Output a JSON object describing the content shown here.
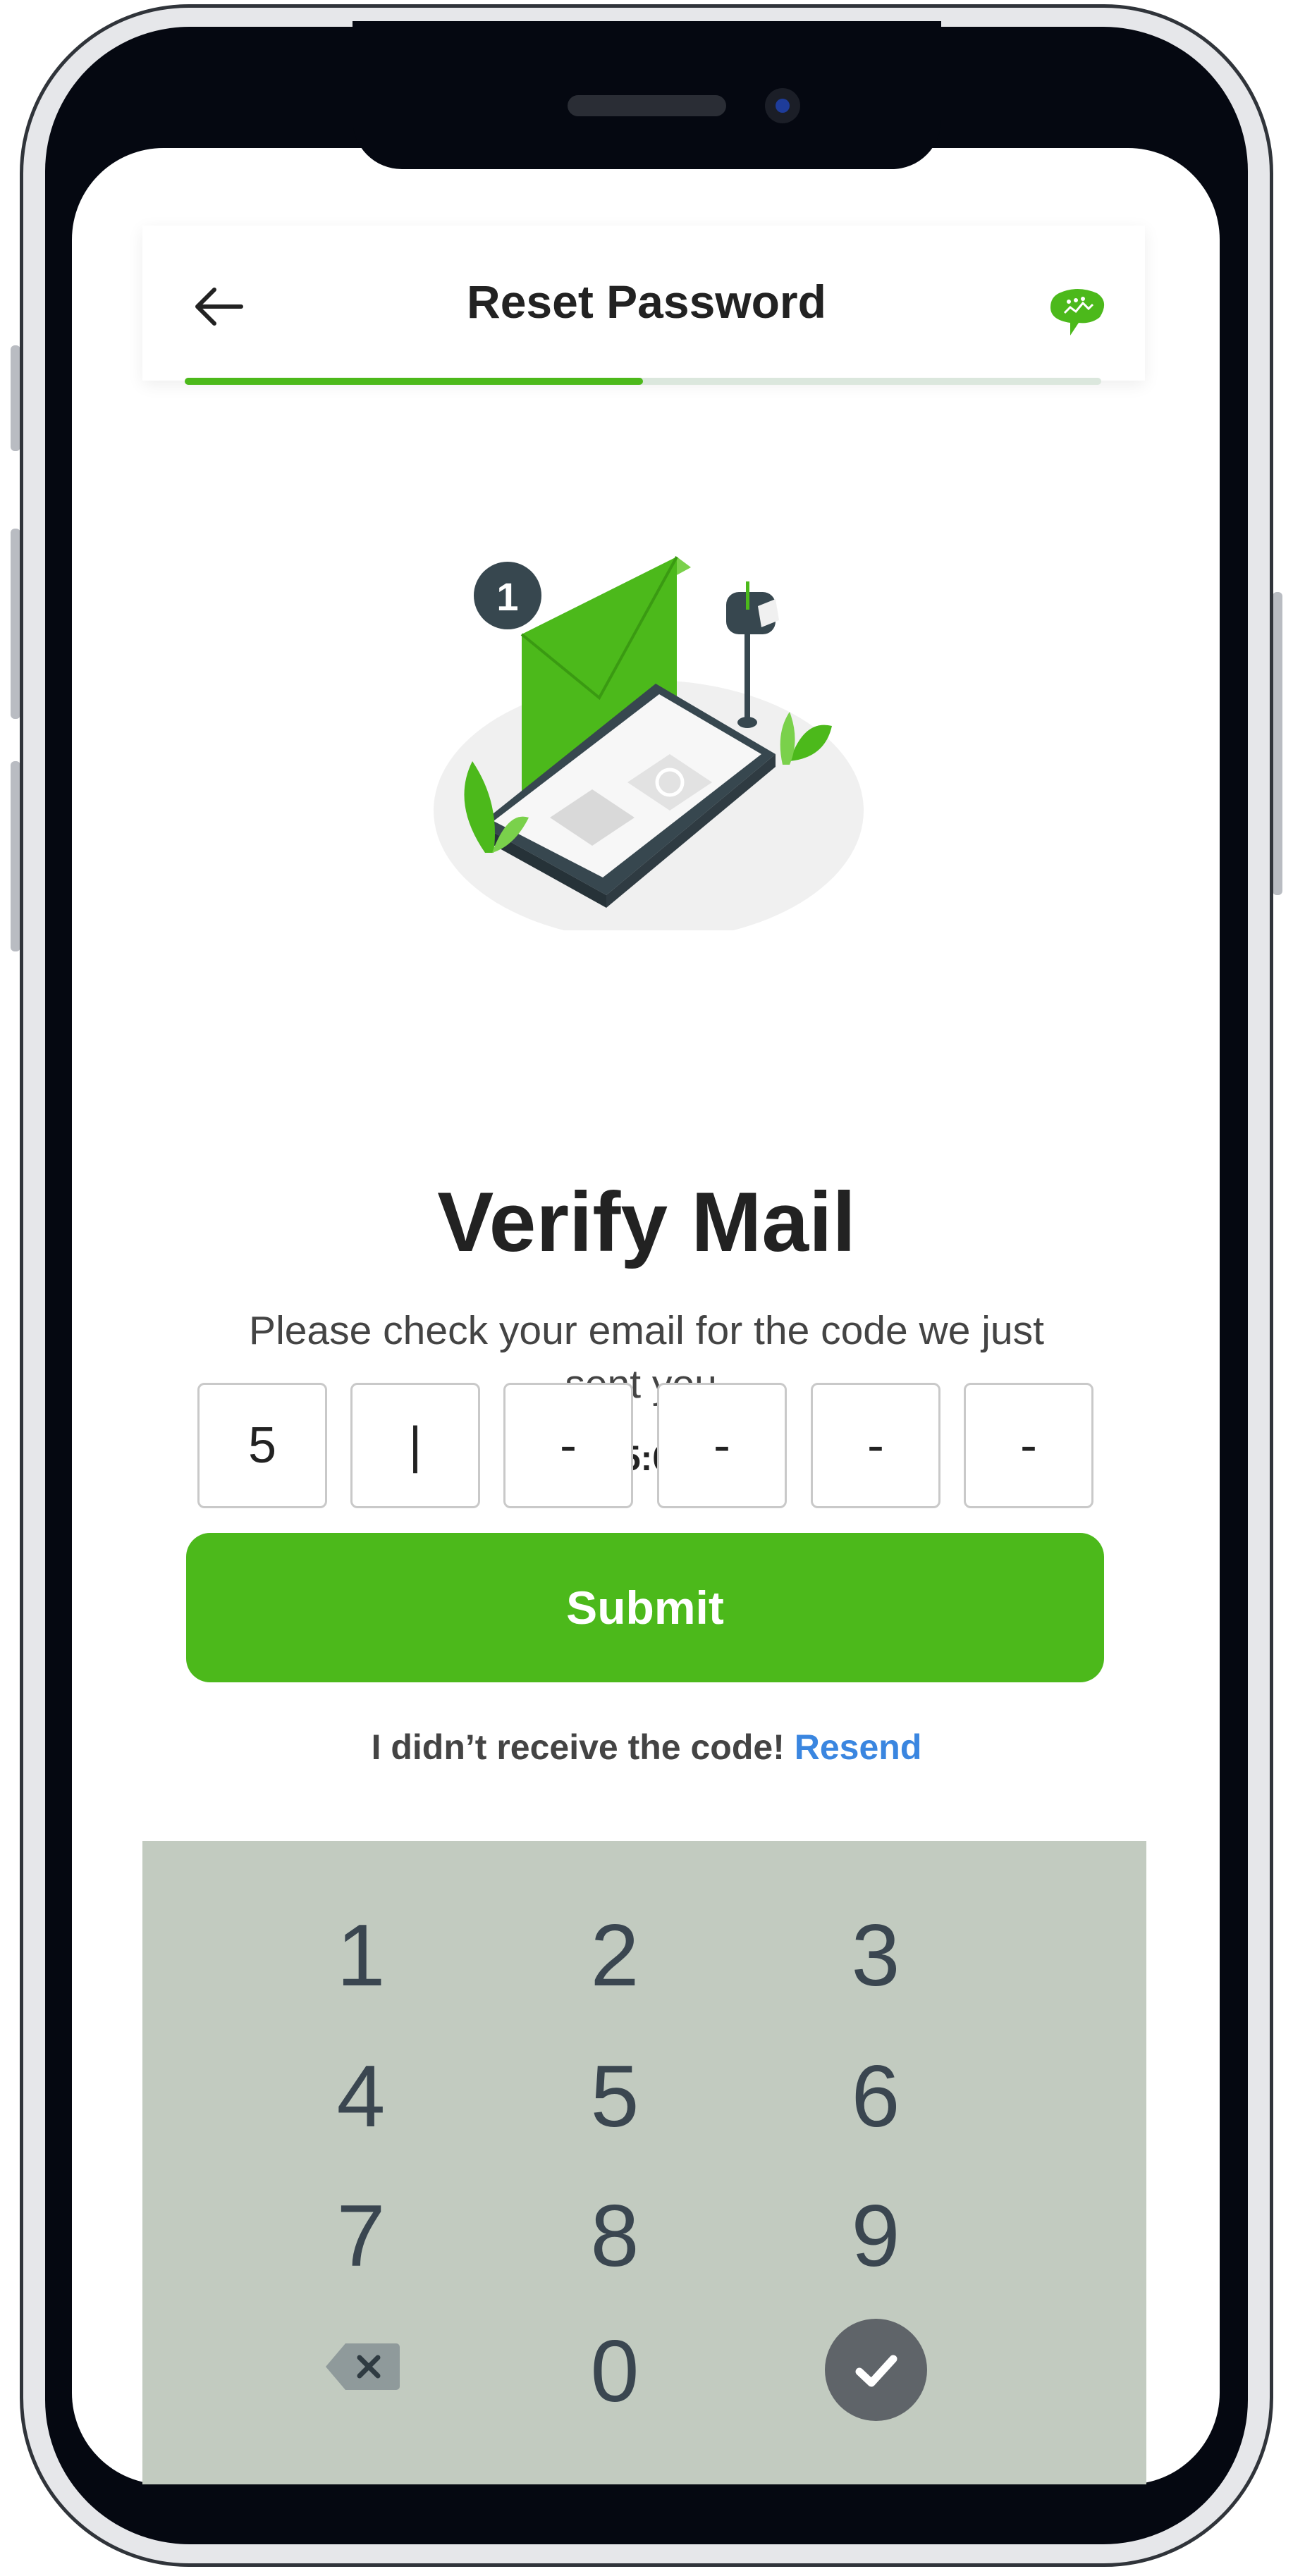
{
  "header": {
    "title": "Reset Password",
    "back_icon": "back-arrow-icon",
    "logo_icon": "brain-chat-logo-icon",
    "progress": 0.5
  },
  "verify": {
    "heading": "Verify Mail",
    "subtext": "Please check your email for the code we just sent you.",
    "timer": "05:00"
  },
  "otp": {
    "digits": [
      "5",
      "|",
      "-",
      "-",
      "-",
      "-"
    ]
  },
  "submit": {
    "label": "Submit"
  },
  "resend": {
    "prompt": "I didn’t receive the code!",
    "link": "Resend"
  },
  "keypad": {
    "keys": [
      "1",
      "2",
      "3",
      "4",
      "5",
      "6",
      "7",
      "8",
      "9",
      "0"
    ],
    "backspace_icon": "backspace-icon",
    "confirm_icon": "check-icon"
  },
  "illustration": {
    "badge_number": "1"
  },
  "colors": {
    "accent": "#4CB91B",
    "link": "#3A86E0",
    "keypad_bg": "#C2CBC0"
  }
}
